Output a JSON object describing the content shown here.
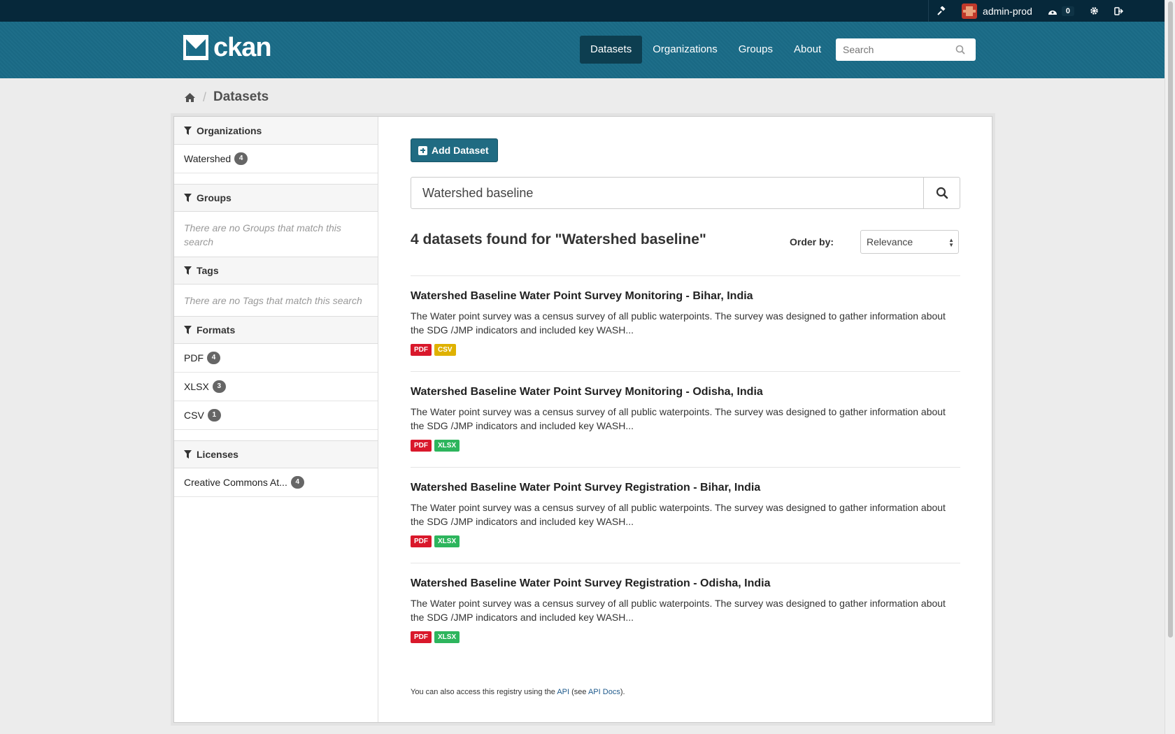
{
  "account": {
    "username": "admin-prod",
    "activity_count": "0"
  },
  "header": {
    "logo_text": "ckan",
    "nav": [
      {
        "label": "Datasets",
        "active": true
      },
      {
        "label": "Organizations",
        "active": false
      },
      {
        "label": "Groups",
        "active": false
      },
      {
        "label": "About",
        "active": false
      }
    ],
    "search_placeholder": "Search"
  },
  "breadcrumb": {
    "current": "Datasets"
  },
  "sidebar": {
    "organizations": {
      "title": "Organizations",
      "items": [
        {
          "label": "Watershed",
          "count": "4"
        }
      ]
    },
    "groups": {
      "title": "Groups",
      "empty": "There are no Groups that match this search"
    },
    "tags": {
      "title": "Tags",
      "empty": "There are no Tags that match this search"
    },
    "formats": {
      "title": "Formats",
      "items": [
        {
          "label": "PDF",
          "count": "4"
        },
        {
          "label": "XLSX",
          "count": "3"
        },
        {
          "label": "CSV",
          "count": "1"
        }
      ]
    },
    "licenses": {
      "title": "Licenses",
      "items": [
        {
          "label": "Creative Commons At...",
          "count": "4"
        }
      ]
    }
  },
  "main": {
    "add_button": "Add Dataset",
    "search_value": "Watershed baseline",
    "results_title": "4 datasets found for \"Watershed baseline\"",
    "order_label": "Order by:",
    "order_value": "Relevance",
    "datasets": [
      {
        "title": "Watershed Baseline Water Point Survey Monitoring - Bihar, India",
        "description": "The Water point survey was a census survey of all public waterpoints. The survey was designed to gather information about the SDG /JMP indicators and included key WASH...",
        "formats": [
          "PDF",
          "CSV"
        ]
      },
      {
        "title": "Watershed Baseline Water Point Survey Monitoring - Odisha, India",
        "description": "The Water point survey was a census survey of all public waterpoints. The survey was designed to gather information about the SDG /JMP indicators and included key WASH...",
        "formats": [
          "PDF",
          "XLSX"
        ]
      },
      {
        "title": "Watershed Baseline Water Point Survey Registration - Bihar, India",
        "description": "The Water point survey was a census survey of all public waterpoints. The survey was designed to gather information about the SDG /JMP indicators and included key WASH...",
        "formats": [
          "PDF",
          "XLSX"
        ]
      },
      {
        "title": "Watershed Baseline Water Point Survey Registration - Odisha, India",
        "description": "The Water point survey was a census survey of all public waterpoints. The survey was designed to gather information about the SDG /JMP indicators and included key WASH...",
        "formats": [
          "PDF",
          "XLSX"
        ]
      }
    ],
    "footer": {
      "prefix": "You can also access this registry using the ",
      "api_link": "API",
      "middle": " (see ",
      "docs_link": "API Docs",
      "suffix": ")."
    }
  },
  "colors": {
    "account_bar": "#06283a",
    "masthead": "#1a6b87",
    "nav_active": "#0d3e50",
    "pdf": "#d9182b",
    "csv": "#dfb100",
    "xlsx": "#2db55d"
  }
}
